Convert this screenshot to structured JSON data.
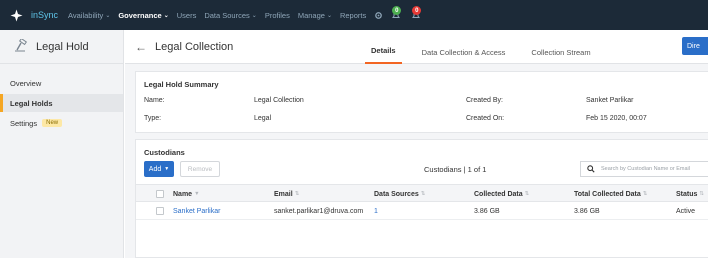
{
  "topbar": {
    "brand": "inSync",
    "nav": [
      {
        "label": "Availability",
        "dropdown": true,
        "active": false
      },
      {
        "label": "Governance",
        "dropdown": true,
        "active": true
      },
      {
        "label": "Users",
        "dropdown": false,
        "active": false
      },
      {
        "label": "Data Sources",
        "dropdown": true,
        "active": false
      },
      {
        "label": "Profiles",
        "dropdown": false,
        "active": false
      },
      {
        "label": "Manage",
        "dropdown": true,
        "active": false
      },
      {
        "label": "Reports",
        "dropdown": false,
        "active": false
      }
    ],
    "notifications": {
      "green_count": "0",
      "red_count": "0"
    }
  },
  "sidebar": {
    "title": "Legal Hold",
    "items": [
      {
        "label": "Overview",
        "active": false
      },
      {
        "label": "Legal Holds",
        "active": true
      },
      {
        "label": "Settings",
        "active": false,
        "badge": "New"
      }
    ]
  },
  "page": {
    "title": "Legal Collection",
    "tabs": [
      {
        "label": "Details",
        "active": true
      },
      {
        "label": "Data Collection & Access",
        "active": false
      },
      {
        "label": "Collection Stream",
        "active": false
      }
    ],
    "action_button": "Dire"
  },
  "summary": {
    "title": "Legal Hold Summary",
    "name_label": "Name:",
    "name_value": "Legal Collection",
    "type_label": "Type:",
    "type_value": "Legal",
    "created_by_label": "Created By:",
    "created_by_value": "Sanket Parlikar",
    "created_on_label": "Created On:",
    "created_on_value": "Feb 15 2020, 00:07"
  },
  "custodians": {
    "title": "Custodians",
    "add_label": "Add",
    "remove_label": "Remove",
    "count_text": "Custodians | 1 of 1",
    "search_placeholder": "Search by Custodian Name or Email",
    "columns": [
      "Name",
      "Email",
      "Data Sources",
      "Collected Data",
      "Total Collected Data",
      "Status"
    ],
    "rows": [
      {
        "name": "Sanket Parlikar",
        "email": "sanket.parlikar1@druva.com",
        "data_sources": "1",
        "collected": "3.86 GB",
        "total_collected": "3.86 GB",
        "status": "Active"
      }
    ]
  },
  "colors": {
    "topbar_bg": "#1c2a38",
    "brand": "#5ec4e8",
    "primary": "#2a6ec8",
    "active_tab": "#f26522",
    "sidebar_active": "#f5a623"
  }
}
